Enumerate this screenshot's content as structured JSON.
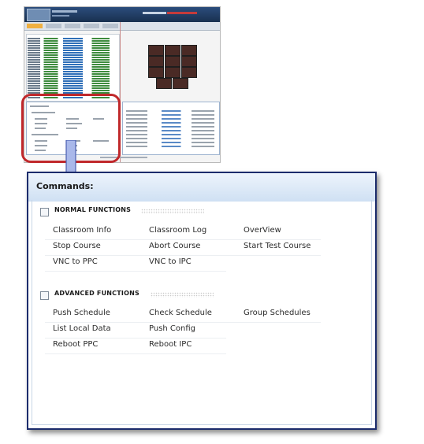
{
  "commands_panel": {
    "title": "Commands:",
    "sections": [
      {
        "label": "NORMAL FUNCTIONS",
        "rows": [
          [
            "Classroom Info",
            "Classroom Log",
            "OverView"
          ],
          [
            "Stop Course",
            "Abort Course",
            "Start Test Course"
          ],
          [
            "VNC to PPC",
            "VNC to IPC",
            ""
          ]
        ]
      },
      {
        "label": "ADVANCED FUNCTIONS",
        "rows": [
          [
            "Push Schedule",
            "Check Schedule",
            "Group Schedules"
          ],
          [
            "List Local Data",
            "Push Config",
            ""
          ],
          [
            "Reboot PPC",
            "Reboot IPC",
            ""
          ]
        ]
      }
    ]
  },
  "colors": {
    "highlight_border": "#c0282b",
    "arrow_fill": "#a9b8ea",
    "panel_border": "#1c2c6c"
  }
}
